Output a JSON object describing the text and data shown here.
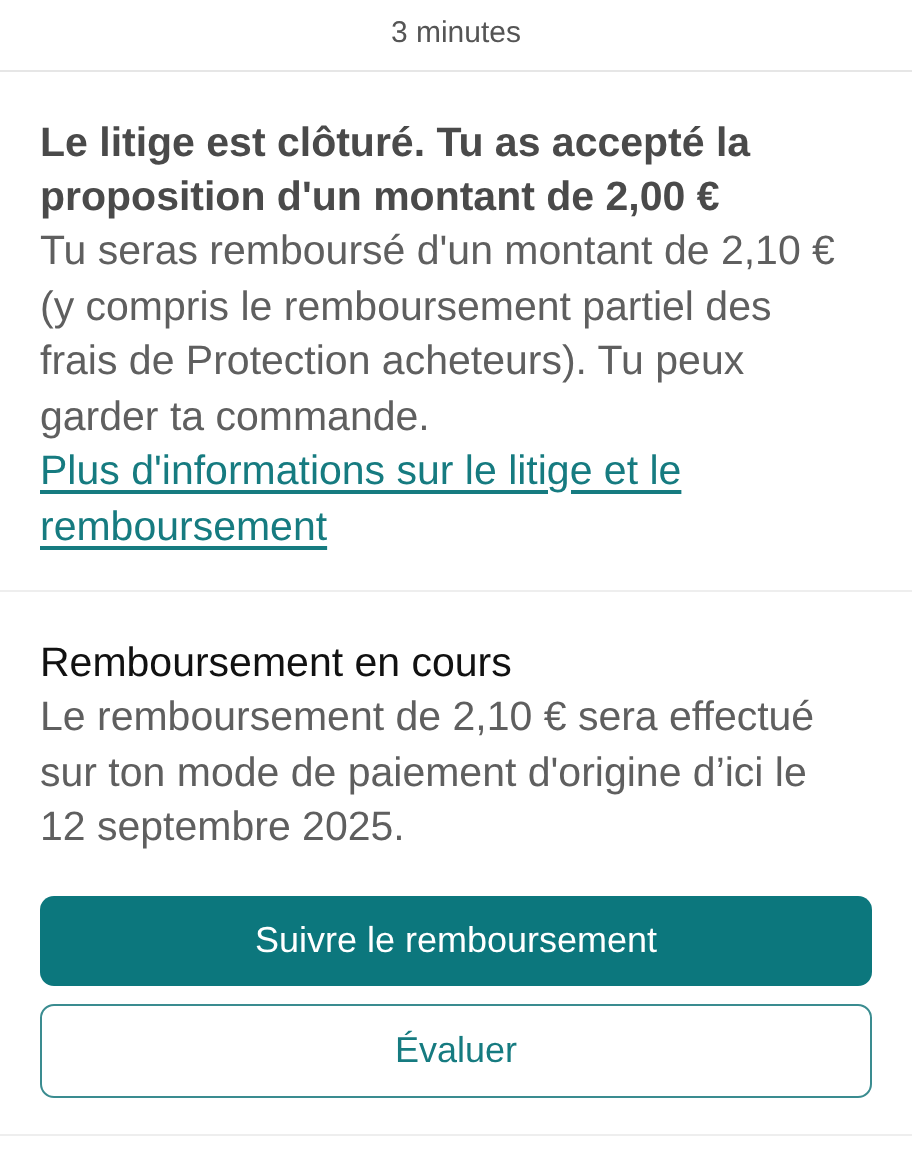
{
  "timestamp": "3 minutes",
  "dispute": {
    "title": "Le litige est clôturé. Tu as accepté la proposition d'un montant de 2,00 €",
    "body": "Tu seras remboursé d'un montant de 2,10 € (y compris le remboursement partiel des frais de Protection acheteurs). Tu peux garder ta commande.",
    "link": "Plus d'informations sur le litige et le remboursement"
  },
  "refund": {
    "title": "Remboursement en cours",
    "body": "Le remboursement de 2,10 € sera effectué sur ton mode de paiement d'origine d’ici le 12 septembre 2025."
  },
  "buttons": [
    {
      "label": "Suivre le remboursement",
      "kind": "primary"
    },
    {
      "label": "Évaluer",
      "kind": "secondary"
    }
  ]
}
